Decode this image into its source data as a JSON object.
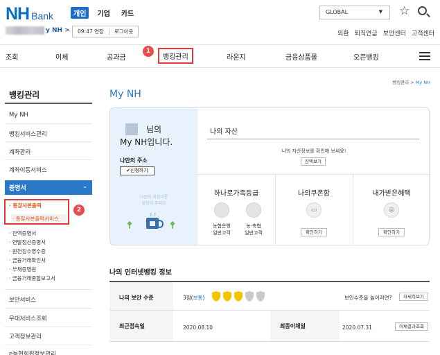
{
  "brand": {
    "logo_nh": "NH",
    "logo_bank": "Bank"
  },
  "biz_tabs": [
    "개인",
    "기업",
    "카드"
  ],
  "header": {
    "global_select": "GLOBAL",
    "user_link": "y NH >",
    "session_time": "09:47 연장",
    "logout": "로그아웃",
    "util_links": [
      "외환",
      "퇴직연금",
      "보안센터",
      "고객센터"
    ]
  },
  "main_menu": [
    "조회",
    "이체",
    "공과금",
    "뱅킹관리",
    "라운지",
    "금융상품몰",
    "오픈뱅킹"
  ],
  "annotations": {
    "badge1": "1",
    "badge2": "2"
  },
  "sidebar": {
    "title": "뱅킹관리",
    "items": [
      "My NH",
      "뱅킹서비스관리",
      "계좌관리",
      "계좌이동서비스"
    ],
    "active": "증명서",
    "sub_selected": "· 통장사본출력",
    "sub_child": "· 통장사본출력서비스",
    "leaves": [
      "· 잔액증명서",
      "· 연말정산증명서",
      "· 원천징수영수증",
      "· 금융거래확인서",
      "· 부채증명원",
      "· 금융거래종합보고서"
    ],
    "bottom_items": [
      "보안서비스",
      "우대서비스조회",
      "고객정보관리",
      "e능협회원정보관리"
    ]
  },
  "breadcrumb": {
    "parent": "뱅킹관리 > ",
    "current": "My NH"
  },
  "page_title": "My NH",
  "profile": {
    "greet_suffix": "님의",
    "greet_line2": "My NH입니다.",
    "address_label": "나만의 주소",
    "apply_button": "✔신청하기",
    "faint_line1": "나만의 계좌이름",
    "faint_line2": "설정해 주세요"
  },
  "assets": {
    "title": "나의 자산",
    "message": "나의 자산정보를 확인해 보세요!",
    "button": "잔액보기"
  },
  "grade": {
    "title": "하나로가족등급",
    "left_label": [
      "농협은행",
      "일반고객"
    ],
    "right_label": [
      "농·축협",
      "일반고객"
    ]
  },
  "coupon": {
    "title": "나의쿠폰함",
    "button": "확인하기"
  },
  "benefits": {
    "title": "내가받은혜택",
    "button": "확인하기"
  },
  "info": {
    "title": "나의 인터넷뱅킹 정보",
    "security_label": "나의 보안 수준",
    "security_level": "3점(",
    "security_level_word": "보통",
    "security_close": ")",
    "security_score": 3,
    "security_max": 5,
    "security_prompt": "보안수준을 높이려면?",
    "detail_button": "자세히보기",
    "last_access_label": "최근접속일",
    "last_access_value": "2020.08.10",
    "last_transfer_label": "최종이체일",
    "last_transfer_value": "2020.07.31",
    "transfer_result_button": "이체결과조회"
  },
  "colors": {
    "brand_blue": "#2a78c8",
    "highlight_red": "#e53935",
    "shield_gold": "#f2c400",
    "shield_gray": "#c9c9c9"
  }
}
